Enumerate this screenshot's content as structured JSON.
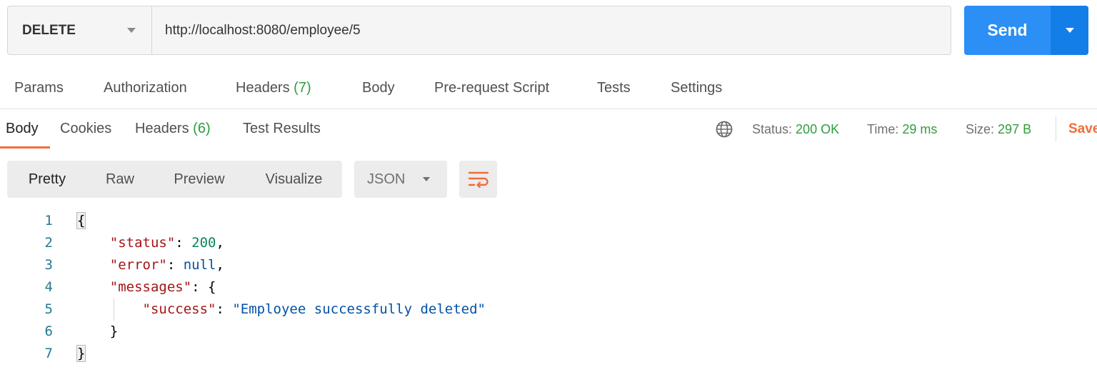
{
  "request": {
    "method": "DELETE",
    "url": "http://localhost:8080/employee/5",
    "send_label": "Send"
  },
  "request_tabs": [
    {
      "label": "Params"
    },
    {
      "label": "Authorization"
    },
    {
      "label": "Headers",
      "count": "(7)"
    },
    {
      "label": "Body"
    },
    {
      "label": "Pre-request Script"
    },
    {
      "label": "Tests"
    },
    {
      "label": "Settings"
    }
  ],
  "response_tabs": [
    {
      "label": "Body",
      "active": true
    },
    {
      "label": "Cookies"
    },
    {
      "label": "Headers",
      "count": "(6)"
    },
    {
      "label": "Test Results"
    }
  ],
  "response_meta": {
    "status_label": "Status:",
    "status_value": "200 OK",
    "time_label": "Time:",
    "time_value": "29 ms",
    "size_label": "Size:",
    "size_value": "297 B",
    "save_label": "Save"
  },
  "view_modes": [
    {
      "label": "Pretty",
      "active": true
    },
    {
      "label": "Raw"
    },
    {
      "label": "Preview"
    },
    {
      "label": "Visualize"
    }
  ],
  "format": {
    "selected": "JSON"
  },
  "icons": {
    "globe": "globe-icon",
    "wrap": "wrap-lines-icon",
    "dropdown": "chevron-down-icon"
  },
  "colors": {
    "send": "#2b8ff5",
    "accent": "#f26b3a",
    "status_ok": "#2e9d3d"
  },
  "code_lines": [
    {
      "n": "1",
      "parts": [
        [
          "p",
          "{"
        ]
      ]
    },
    {
      "n": "2",
      "parts": [
        [
          "ws",
          "    "
        ],
        [
          "k",
          "\"status\""
        ],
        [
          "p",
          ": "
        ],
        [
          "n",
          "200"
        ],
        [
          "p",
          ","
        ]
      ]
    },
    {
      "n": "3",
      "parts": [
        [
          "ws",
          "    "
        ],
        [
          "k",
          "\"error\""
        ],
        [
          "p",
          ": "
        ],
        [
          "kw",
          "null"
        ],
        [
          "p",
          ","
        ]
      ]
    },
    {
      "n": "4",
      "parts": [
        [
          "ws",
          "    "
        ],
        [
          "k",
          "\"messages\""
        ],
        [
          "p",
          ": {"
        ]
      ]
    },
    {
      "n": "5",
      "parts": [
        [
          "ws",
          "        "
        ],
        [
          "k",
          "\"success\""
        ],
        [
          "p",
          ": "
        ],
        [
          "s",
          "\"Employee successfully deleted\""
        ]
      ]
    },
    {
      "n": "6",
      "parts": [
        [
          "ws",
          "    "
        ],
        [
          "p",
          "}"
        ]
      ]
    },
    {
      "n": "7",
      "parts": [
        [
          "p",
          "}"
        ]
      ]
    }
  ]
}
